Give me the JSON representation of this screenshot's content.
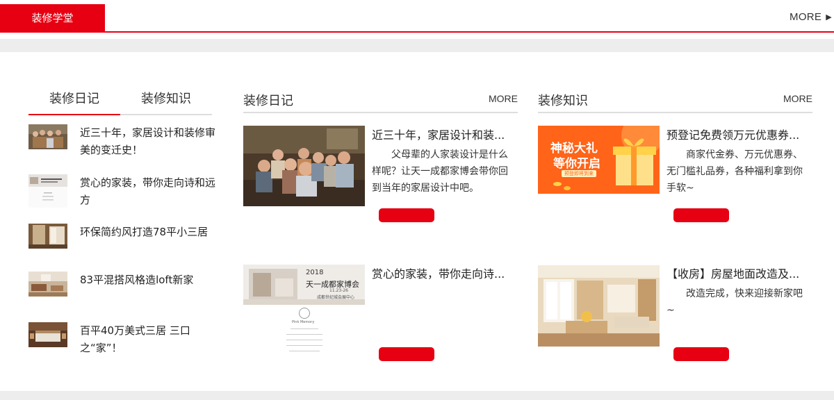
{
  "header": {
    "tab_label": "装修学堂",
    "more_label": "MORE",
    "more_arrow": "▶"
  },
  "left_panel": {
    "tabs": [
      {
        "label": "装修日记",
        "active": true
      },
      {
        "label": "装修知识",
        "active": false
      }
    ],
    "items": [
      {
        "title": "近三十年，家居设计和装修审美的变迁史！"
      },
      {
        "title": "赏心的家装，带你走向诗和远方"
      },
      {
        "title": "环保简约风打造78平小三居"
      },
      {
        "title": "83平混搭风格造loft新家"
      },
      {
        "title": "百平40万美式三居 三口之“家”！"
      }
    ]
  },
  "diary_section": {
    "heading": "装修日记",
    "more_label": "MORE",
    "cards": [
      {
        "title": "近三十年，家居设计和装...",
        "desc": "父母辈的人家装设计是什么样呢？让天一成都家博会带你回到当年的家居设计中吧。"
      },
      {
        "title": "赏心的家装，带你走向诗...",
        "desc": "",
        "poster": {
          "year": "2018",
          "name": "天一成都家博会",
          "date": "11.23-26",
          "venue": "成都世纪城会展中心",
          "brand": "Pink Memory"
        }
      }
    ]
  },
  "knowledge_section": {
    "heading": "装修知识",
    "more_label": "MORE",
    "cards": [
      {
        "title": "预登记免费领万元优惠券...",
        "desc": "商家代金券、万元优惠券、无门槛礼品券，各种福利拿到你手软~",
        "banner": {
          "line1": "神秘大礼",
          "line2": "等你开启",
          "tag": "预登即将到来"
        }
      },
      {
        "title": "【收房】房屋地面改造及...",
        "desc": "改造完成，快来迎接新家吧~"
      }
    ]
  },
  "colors": {
    "accent": "#e60012",
    "page_bg": "#ededed"
  }
}
